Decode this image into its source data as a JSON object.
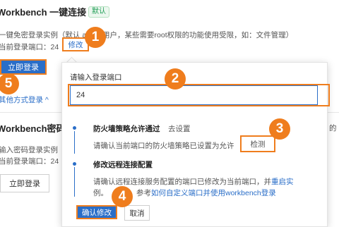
{
  "section1": {
    "title": "Workbench 一键连接",
    "badge": "默认",
    "desc": "一键免密登录实例（默认 admin用户，某些需要root权限的功能使用受限，如：文件管理）",
    "port_label": "当前登录端口：24",
    "modify_link": "修改",
    "login_button": "立即登录",
    "other_methods_link": "其他方式登录 ^"
  },
  "section2": {
    "title": "Workbench密码登",
    "desc": "输入密码登录实例",
    "port_label": "当前登录端口：24",
    "login_button": "立即登录",
    "right_text": "的"
  },
  "popover": {
    "label": "请输入登录端口",
    "input_value": "24",
    "step1_title": "防火墙策略允许通过",
    "step1_link": "去设置",
    "step1_desc": "请确认当前端口的防火墙策略已设置为允许",
    "step1_detect": "检测",
    "step2_title": "修改远程连接配置",
    "step2_desc_part1": "请确认远程连接服务配置的端口已修改为当前端口，并",
    "step2_restart_link": "重启实",
    "step2_desc_line2": "例。",
    "step2_reference_text": "参考",
    "step2_doc_link": "如何自定义端口并使用workbench登录",
    "confirm_button": "确认修改",
    "cancel_button": "取消"
  },
  "annotations": [
    "1",
    "2",
    "3",
    "4",
    "5"
  ],
  "colors": {
    "accent": "#2a6ec8",
    "callout": "#ef7d1d",
    "badge": "#1f9d55"
  }
}
